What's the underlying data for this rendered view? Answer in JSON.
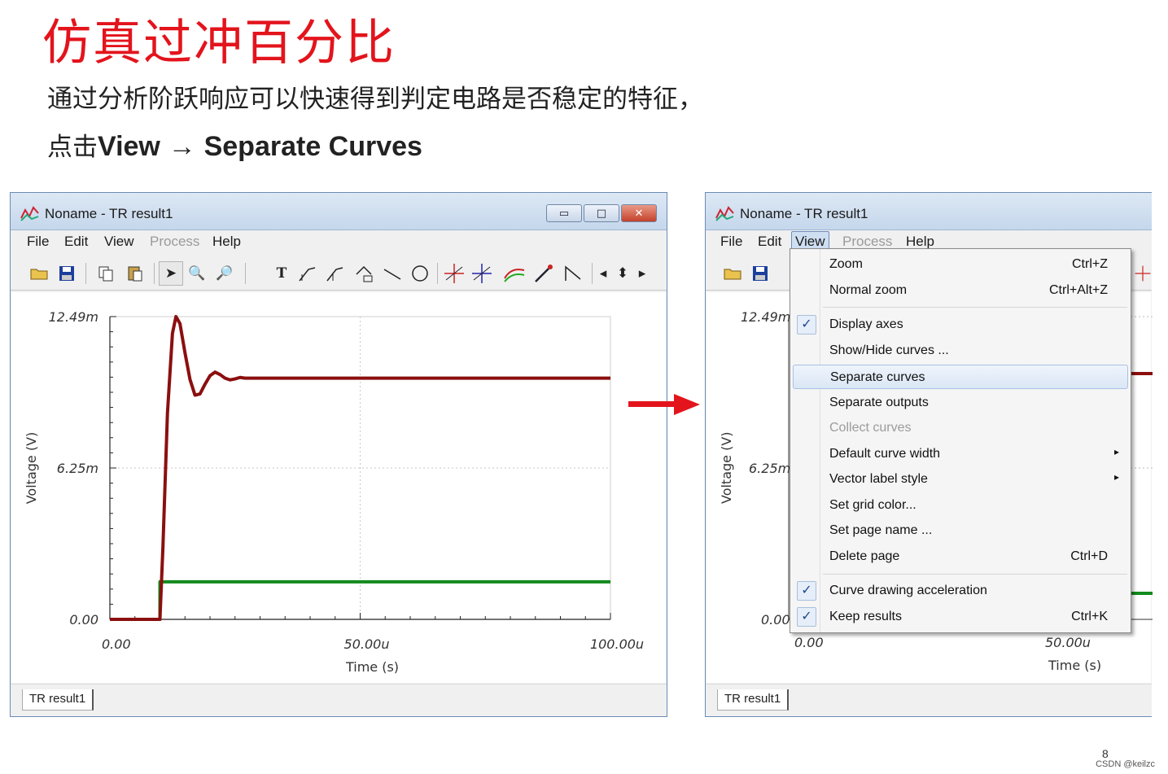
{
  "slide": {
    "title": "仿真过冲百分比",
    "subtitle": "通过分析阶跃响应可以快速得到判定电路是否稳定的特征，",
    "instruction_prefix": "点击",
    "instruction_view": "View",
    "instruction_arrow": "→",
    "instruction_target": "Separate Curves",
    "page_number": "8",
    "watermark": "CSDN @keilzc"
  },
  "colors": {
    "title_red": "#e3141c",
    "curve_red": "#8b0f0f",
    "curve_green": "#138a1e",
    "arrow_red": "#e3141c"
  },
  "window_left": {
    "title": "Noname - TR result1",
    "menus": [
      "File",
      "Edit",
      "View",
      "Process",
      "Help"
    ],
    "disabled_menu": "Process",
    "status_tab": "TR result1",
    "buttons": {
      "minimize": "▭",
      "maximize": "□",
      "close": "✕"
    }
  },
  "window_right": {
    "title": "Noname - TR result1",
    "menus": [
      "File",
      "Edit",
      "View",
      "Process",
      "Help"
    ],
    "open_menu": "View",
    "status_tab": "TR result1",
    "ytick_top": "12.49m",
    "ytick_mid": "6.25m",
    "ytick_bottom": "0.00",
    "xtick_start": "0.00",
    "xtick_mid": "50.00u",
    "ylabel": "Voltage (V)",
    "xlabel": "Time (s)"
  },
  "view_menu": {
    "items": [
      {
        "label": "Zoom",
        "shortcut": "Ctrl+Z"
      },
      {
        "label": "Normal zoom",
        "shortcut": "Ctrl+Alt+Z"
      },
      {
        "label": "Display axes",
        "checked": true
      },
      {
        "label": "Show/Hide curves ..."
      },
      {
        "label": "Separate curves",
        "highlighted": true
      },
      {
        "label": "Separate outputs"
      },
      {
        "label": "Collect curves",
        "disabled": true
      },
      {
        "label": "Default curve width",
        "submenu": true
      },
      {
        "label": "Vector label style",
        "submenu": true
      },
      {
        "label": "Set grid color..."
      },
      {
        "label": "Set page name ..."
      },
      {
        "label": "Delete page",
        "shortcut": "Ctrl+D"
      },
      {
        "label": "Curve drawing acceleration",
        "checked": true
      },
      {
        "label": "Keep results",
        "checked": true,
        "shortcut": "Ctrl+K"
      }
    ],
    "checkmark": "✓",
    "submenu_arrow": "▸"
  },
  "chart_data": {
    "type": "line",
    "xlabel": "Time (s)",
    "ylabel": "Voltage (V)",
    "xlim": [
      0,
      100
    ],
    "ylim": [
      0,
      12.49
    ],
    "x_unit": "u",
    "y_unit": "m",
    "xticks": [
      "0.00",
      "50.00u",
      "100.00u"
    ],
    "yticks": [
      "0.00",
      "6.25m",
      "12.49m"
    ],
    "grid": true,
    "series": [
      {
        "color": "#8b0f0f",
        "x": [
          0,
          10,
          10.6,
          11.5,
          12.5,
          13.2,
          14,
          15,
          16,
          17,
          18,
          19,
          20,
          21,
          22,
          23,
          24,
          25,
          26,
          27,
          28,
          100
        ],
        "y": [
          0,
          0,
          3.0,
          8.5,
          11.8,
          12.49,
          12.2,
          11.0,
          9.9,
          9.25,
          9.3,
          9.7,
          10.05,
          10.2,
          10.1,
          9.95,
          9.88,
          9.92,
          9.98,
          9.95,
          9.95,
          9.95
        ]
      },
      {
        "color": "#138a1e",
        "x": [
          0,
          10,
          10,
          100
        ],
        "y": [
          0,
          0,
          1.55,
          1.55
        ]
      }
    ]
  }
}
